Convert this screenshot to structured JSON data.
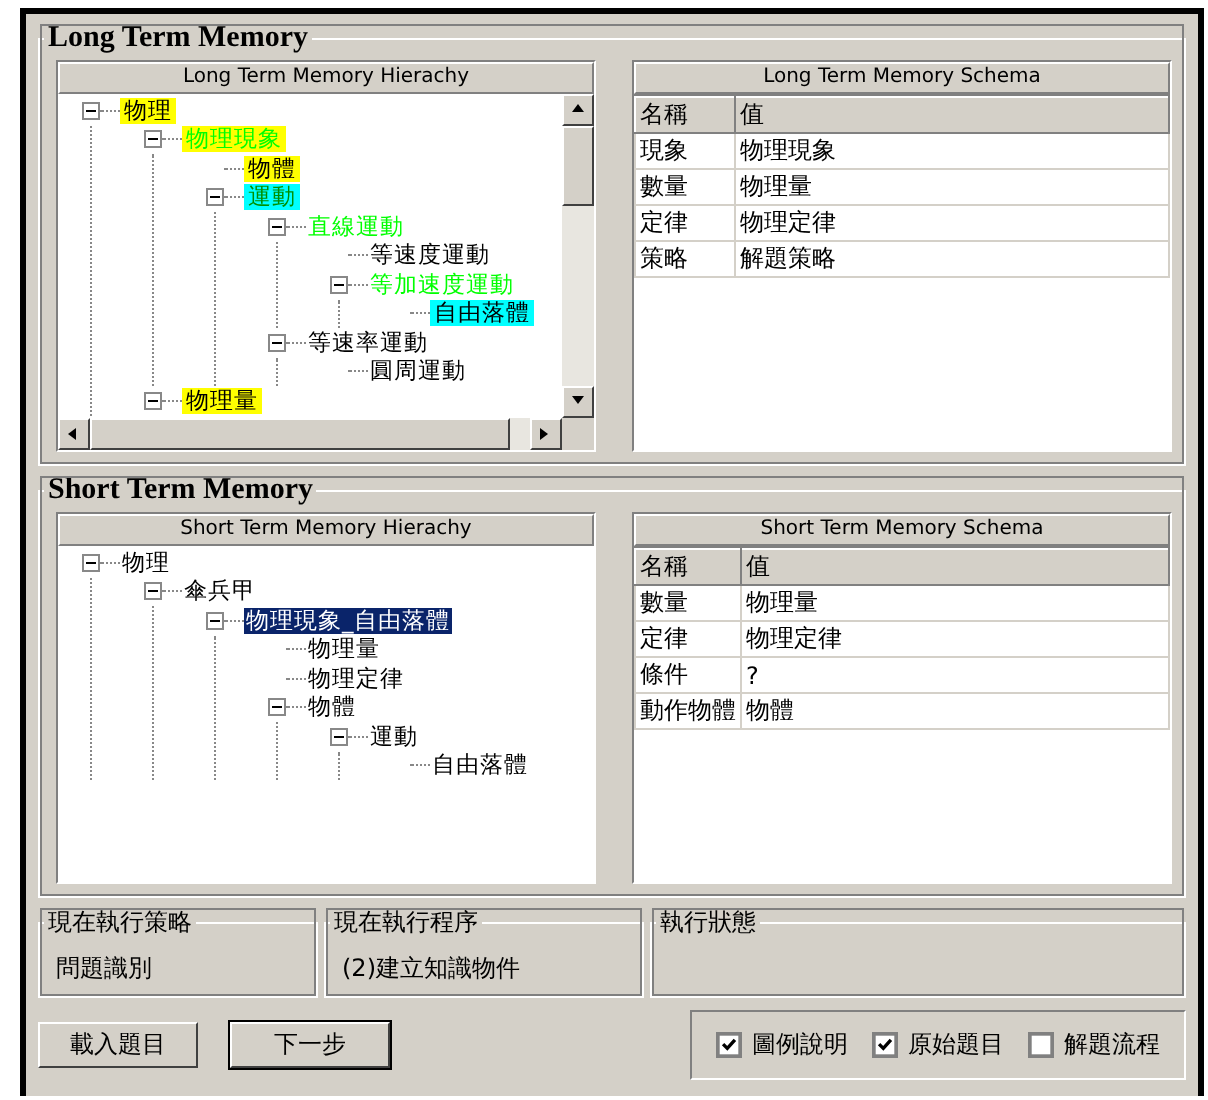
{
  "long_term_memory": {
    "title": "Long Term Memory",
    "hierarchy": {
      "header": "Long Term Memory Hierachy",
      "scroll": true,
      "nodes": [
        {
          "label": "物理",
          "active": false,
          "highlight": {
            "color": "#ffff00"
          },
          "selected": false,
          "expanded": true,
          "children": [
            {
              "label": "物理現象",
              "active": true,
              "highlight": {
                "color": "#ffff00"
              },
              "selected": false,
              "expanded": true,
              "children": [
                {
                  "label": "物體",
                  "active": false,
                  "highlight": {
                    "color": "#ffff00"
                  },
                  "selected": false
                },
                {
                  "label": "運動",
                  "active": true,
                  "highlight": {
                    "color": "#00ffff"
                  },
                  "selected": false,
                  "expanded": true,
                  "children": [
                    {
                      "label": "直線運動",
                      "active": true,
                      "selected": false,
                      "expanded": true,
                      "children": [
                        {
                          "label": "等速度運動",
                          "active": false,
                          "selected": false
                        },
                        {
                          "label": "等加速度運動",
                          "active": true,
                          "selected": false,
                          "expanded": true,
                          "children": [
                            {
                              "label": "自由落體",
                              "active": false,
                              "highlight": {
                                "color": "#00ffff"
                              },
                              "selected": false
                            }
                          ]
                        }
                      ]
                    },
                    {
                      "label": "等速率運動",
                      "active": false,
                      "selected": false,
                      "expanded": true,
                      "children": [
                        {
                          "label": "圓周運動",
                          "active": false,
                          "selected": false
                        }
                      ]
                    }
                  ]
                }
              ]
            },
            {
              "label": "物理量",
              "active": false,
              "highlight": {
                "color": "#ffff00"
              },
              "selected": false,
              "expanded": true
            }
          ]
        }
      ]
    },
    "schema": {
      "header": "Long Term Memory Schema",
      "columns": [
        "名稱",
        "值"
      ],
      "rows": [
        [
          "現象",
          "物理現象"
        ],
        [
          "數量",
          "物理量"
        ],
        [
          "定律",
          "物理定律"
        ],
        [
          "策略",
          "解題策略"
        ]
      ]
    }
  },
  "short_term_memory": {
    "title": "Short Term Memory",
    "hierarchy": {
      "header": "Short Term Memory Hierachy",
      "scroll": false,
      "nodes": [
        {
          "label": "物理",
          "selected": false,
          "expanded": true,
          "children": [
            {
              "label": "傘兵甲",
              "selected": false,
              "expanded": true,
              "children": [
                {
                  "label": "物理現象_自由落體",
                  "selected": true,
                  "expanded": true,
                  "children": [
                    {
                      "label": "物理量",
                      "selected": false
                    },
                    {
                      "label": "物理定律",
                      "selected": false
                    },
                    {
                      "label": "物體",
                      "selected": false,
                      "expanded": true,
                      "children": [
                        {
                          "label": "運動",
                          "selected": false,
                          "expanded": true,
                          "children": [
                            {
                              "label": "自由落體",
                              "selected": false
                            }
                          ]
                        }
                      ]
                    }
                  ]
                }
              ]
            }
          ]
        }
      ]
    },
    "schema": {
      "header": "Short Term Memory Schema",
      "columns": [
        "名稱",
        "值"
      ],
      "rows": [
        [
          "數量",
          "物理量"
        ],
        [
          "定律",
          "物理定律"
        ],
        [
          "條件",
          "?"
        ],
        [
          "動作物體",
          "物體"
        ]
      ]
    }
  },
  "status": [
    {
      "label": "現在執行策略",
      "value": "問題識別"
    },
    {
      "label": "現在執行程序",
      "value": "(2)建立知識物件"
    },
    {
      "label": "執行狀態"
    }
  ],
  "buttons": [
    {
      "label": "載入題目",
      "default": false
    },
    {
      "label": "下一步",
      "default": true
    }
  ],
  "options": [
    {
      "label": "圖例說明",
      "checked": true
    },
    {
      "label": "原始題目",
      "checked": true
    },
    {
      "label": "解題流程",
      "checked": false
    }
  ]
}
